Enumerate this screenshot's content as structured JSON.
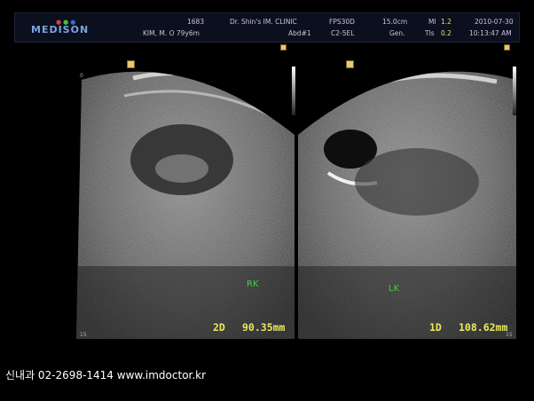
{
  "header": {
    "logo": "MEDISON",
    "id": "1683",
    "patient": "KIM, M. O 79y6m",
    "clinic": "Dr. Shin's IM. CLINIC",
    "study": "Abd#1",
    "preset": "FPS30D",
    "probe": "C2-5EL",
    "depth": "15.0cm",
    "mode": "Gen.",
    "mi_label": "MI",
    "mi_value": "1.2",
    "tis_label": "TIs",
    "tis_value": "0.2",
    "date": "2010-07-30",
    "time": "10:13:47 AM"
  },
  "left_panel": {
    "organ": "RK",
    "measure_id": "2D",
    "measure_value": "90.35mm"
  },
  "right_panel": {
    "organ": "LK",
    "measure_id": "1D",
    "measure_value": "108.62mm"
  },
  "depth_ticks": {
    "top": "0",
    "bottom": "15"
  },
  "footer": "신내과 02-2698-1414  www.imdoctor.kr"
}
